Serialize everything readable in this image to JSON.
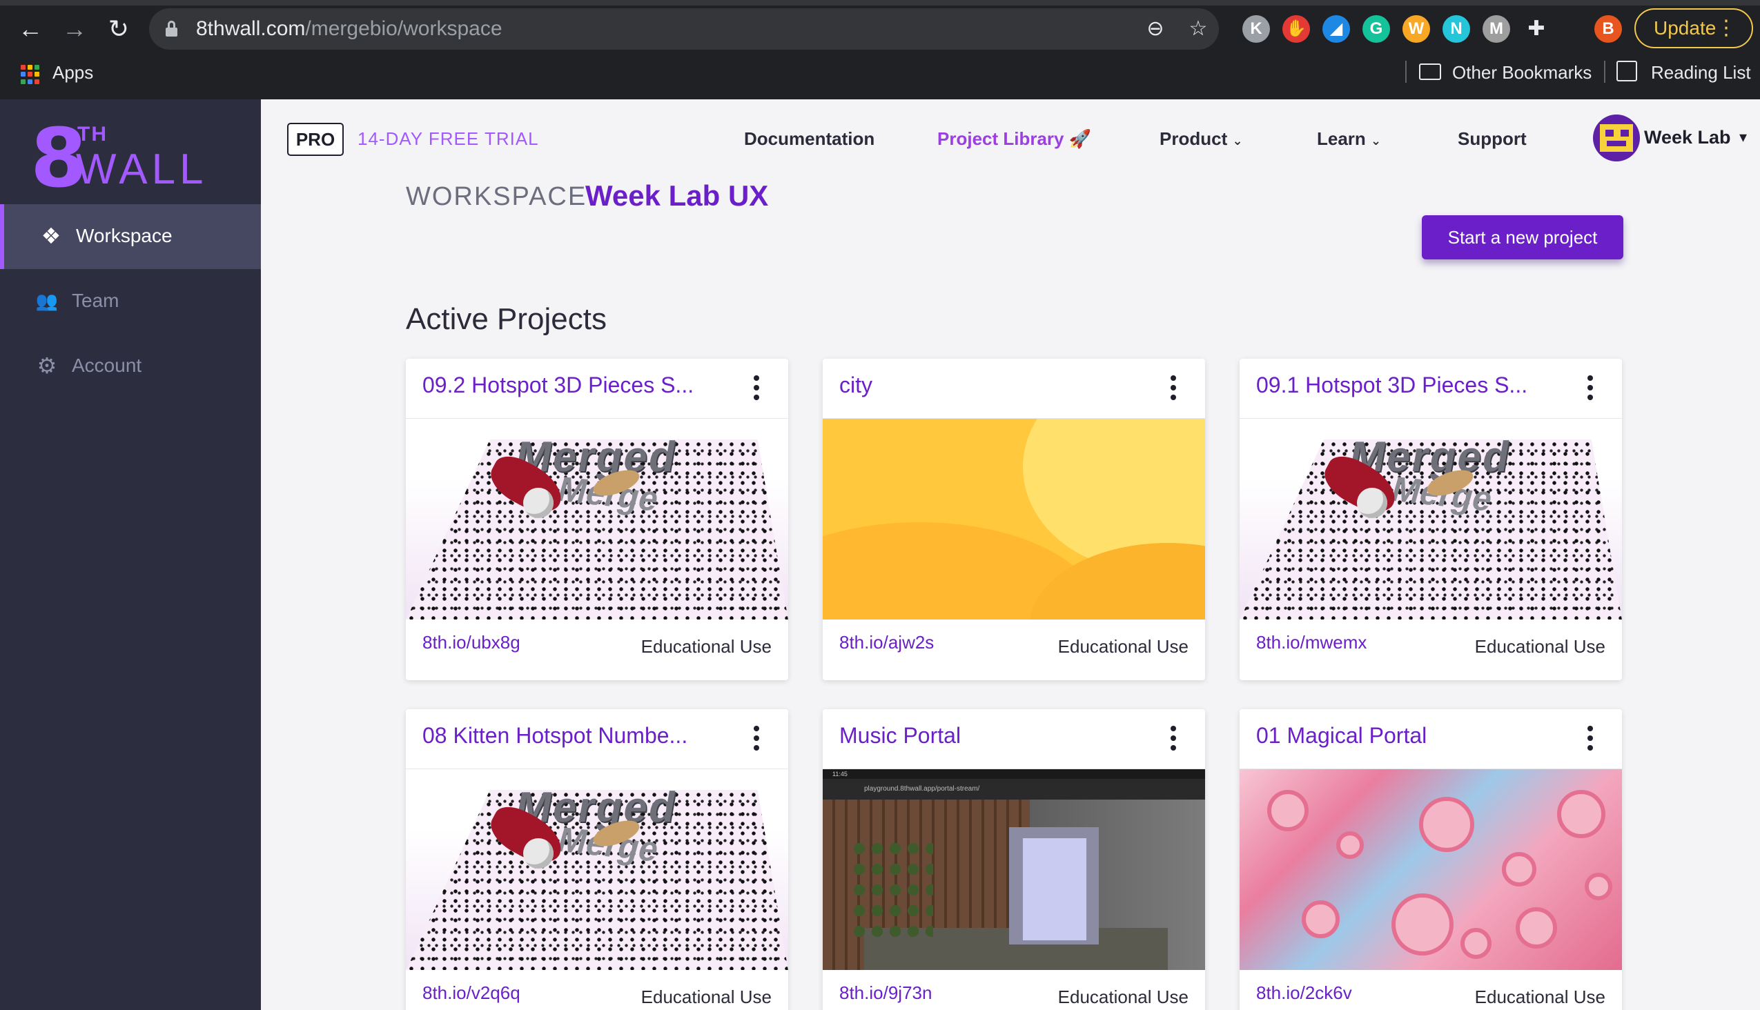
{
  "browser": {
    "url_host": "8thwall.com",
    "url_path": "/mergebio/workspace",
    "update_label": "Update",
    "apps_label": "Apps",
    "other_bookmarks_label": "Other Bookmarks",
    "reading_list_label": "Reading List",
    "extensions": [
      {
        "name": "k-extension-icon",
        "glyph": "K",
        "color": "#9aa0a6"
      },
      {
        "name": "adblock-icon",
        "glyph": "✋",
        "color": "#e53935"
      },
      {
        "name": "bird-extension-icon",
        "glyph": "◢",
        "color": "#1e88e5"
      },
      {
        "name": "grammarly-icon",
        "glyph": "G",
        "color": "#15c39a"
      },
      {
        "name": "w-extension-icon",
        "glyph": "W",
        "color": "#f9a825"
      },
      {
        "name": "n-extension-icon",
        "glyph": "N",
        "color": "#26c6da"
      },
      {
        "name": "m-extension-icon",
        "glyph": "M",
        "color": "#9e9e9e"
      }
    ],
    "profile_initial": "B"
  },
  "sidebar": {
    "logo_th": "TH",
    "logo_wall": "WALL",
    "items": [
      {
        "label": "Workspace",
        "icon": "cubes-icon",
        "glyph": "❖",
        "active": true
      },
      {
        "label": "Team",
        "icon": "users-icon",
        "glyph": "👥",
        "active": false
      },
      {
        "label": "Account",
        "icon": "gear-icon",
        "glyph": "⚙",
        "active": false
      }
    ]
  },
  "topnav": {
    "pro_label": "PRO",
    "trial_label": "14-DAY FREE TRIAL",
    "documentation": "Documentation",
    "project_library": "Project Library",
    "product": "Product",
    "learn": "Learn",
    "support": "Support",
    "user_name": "Week Lab"
  },
  "workspace": {
    "label": "WORKSPACE",
    "name": "Week Lab UX",
    "new_project_label": "Start a new project",
    "section_title": "Active Projects"
  },
  "projects": [
    {
      "title": "09.2 Hotspot 3D Pieces S...",
      "link": "8th.io/ubx8g",
      "use": "Educational Use",
      "thumb": "merged"
    },
    {
      "title": "city",
      "link": "8th.io/ajw2s",
      "use": "Educational Use",
      "thumb": "city"
    },
    {
      "title": "09.1 Hotspot 3D Pieces S...",
      "link": "8th.io/mwemx",
      "use": "Educational Use",
      "thumb": "merged"
    },
    {
      "title": "08 Kitten Hotspot Numbe...",
      "link": "8th.io/v2q6q",
      "use": "Educational Use",
      "thumb": "merged"
    },
    {
      "title": "Music Portal",
      "link": "8th.io/9j73n",
      "use": "Educational Use",
      "thumb": "portal"
    },
    {
      "title": "01 Magical Portal",
      "link": "8th.io/2ck6v",
      "use": "Educational Use",
      "thumb": "marble"
    }
  ],
  "thumb_text": {
    "merged_word": "Merged",
    "merge_word": "Merge",
    "phone_time": "11:45",
    "phone_url": "playground.8thwall.app/portal-stream/"
  },
  "colors": {
    "accent": "#6a1fc8",
    "accent_light": "#a259ff",
    "sidebar_bg": "#2c2d3f"
  }
}
